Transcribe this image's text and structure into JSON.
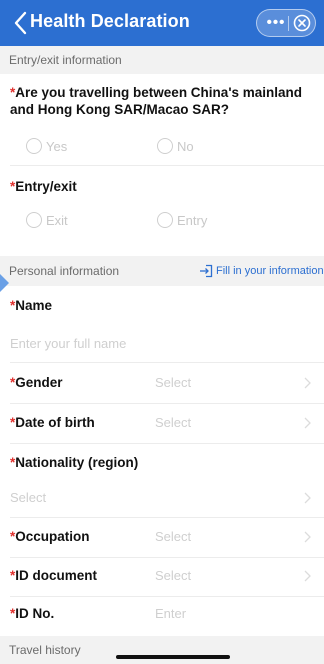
{
  "nav": {
    "title": "Health Declaration",
    "back_icon": "chevron-left-icon",
    "more_icon": "more-dots-icon",
    "more_glyph": "•••",
    "close_icon": "close-circle-icon",
    "accent_color": "#2c6fd1"
  },
  "sections": {
    "entry_exit": "Entry/exit information",
    "personal": "Personal information",
    "travel_history": "Travel history"
  },
  "questions": {
    "travelling": {
      "required_mark": "*",
      "label": "Are you travelling between China's mainland and Hong Kong SAR/Macao SAR?",
      "options": [
        "Yes",
        "No"
      ]
    },
    "entry_exit": {
      "required_mark": "*",
      "label": "Entry/exit",
      "options": [
        "Exit",
        "Entry"
      ]
    }
  },
  "fill_info": {
    "icon": "sign-in-icon",
    "label": "Fill in your information"
  },
  "fields": {
    "name": {
      "required_mark": "*",
      "label": "Name",
      "placeholder": "Enter your full name"
    },
    "gender": {
      "required_mark": "*",
      "label": "Gender",
      "value": "Select"
    },
    "dob": {
      "required_mark": "*",
      "label": "Date of birth",
      "value": "Select"
    },
    "nationality": {
      "required_mark": "*",
      "label": "Nationality (region)",
      "value": "Select"
    },
    "occupation": {
      "required_mark": "*",
      "label": "Occupation",
      "value": "Select"
    },
    "id_document": {
      "required_mark": "*",
      "label": "ID document",
      "value": "Select"
    },
    "id_no": {
      "required_mark": "*",
      "label": "ID No.",
      "value": "Enter"
    }
  },
  "colors": {
    "required": "#e0312e",
    "placeholder": "#cfcfcf",
    "section_bg": "#f2f2f2"
  }
}
